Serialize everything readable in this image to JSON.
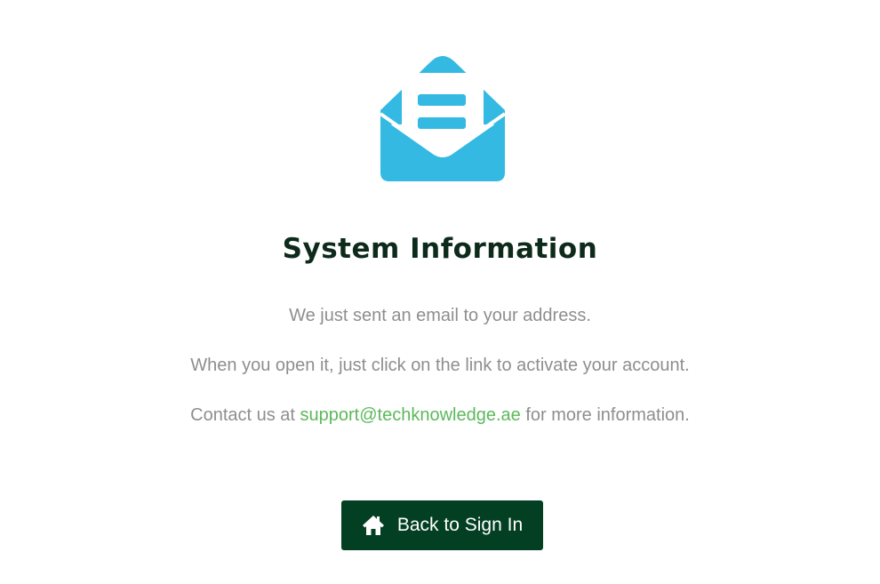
{
  "icon": {
    "name": "envelope-open-icon",
    "color": "#33b9e2"
  },
  "title": "System Information",
  "messages": {
    "line1": "We just sent an email to your address.",
    "line2": "When you open it, just click on the link to activate your account.",
    "line3_prefix": "Contact us at ",
    "line3_email": "support@techknowledge.ae",
    "line3_suffix": " for more information."
  },
  "button": {
    "label": "Back to Sign In",
    "icon": "home-icon"
  },
  "colors": {
    "title": "#0d2a1a",
    "text": "#8e8e8e",
    "link": "#5cb85c",
    "button_bg": "#033f22",
    "button_text": "#ffffff"
  }
}
